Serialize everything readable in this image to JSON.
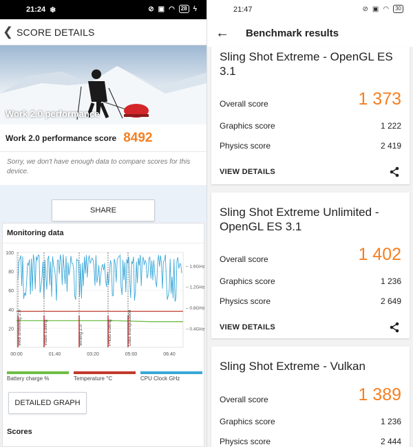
{
  "left": {
    "status": {
      "time": "21:24",
      "battery": "28"
    },
    "appbar": {
      "back_glyph": "❮",
      "title": "SCORE DETAILS"
    },
    "hero": {
      "label": "Work 2.0 performance"
    },
    "score": {
      "label": "Work 2.0 performance score",
      "value": "8492"
    },
    "compare_text": "Sorry, we don't have enough data to compare scores for this device.",
    "share_label": "SHARE",
    "monitoring": {
      "title": "Monitoring data",
      "detailed_label": "DETAILED GRAPH",
      "scores_label": "Scores"
    },
    "colors": {
      "accent": "#f57f20",
      "battery": "#6fbd45",
      "temperature": "#c0392b",
      "cpu": "#3aa8d8"
    }
  },
  "chart_data": {
    "type": "line",
    "xlabel": "",
    "ylabel": "",
    "x_ticks": [
      "00:00",
      "01:40",
      "03:20",
      "05:00",
      "06:40"
    ],
    "y_ticks_left": [
      "20",
      "40",
      "60",
      "80",
      "100"
    ],
    "y_ticks_right": [
      "0.4GHz",
      "0.8GHz",
      "1.2GHz",
      "1.6GHz"
    ],
    "ylim": [
      0,
      100
    ],
    "sections": [
      "Web Browsing 2.0",
      "Video Editing",
      "Writing 2.0",
      "Photo Editing",
      "Data Manipulation"
    ],
    "legend": [
      {
        "name": "Battery charge %",
        "color": "#6fbd45"
      },
      {
        "name": "Temperature °C",
        "color": "#c0392b"
      },
      {
        "name": "CPU Clock GHz",
        "color": "#3aa8d8"
      }
    ],
    "series": [
      {
        "name": "Battery charge %",
        "values": [
          28,
          28,
          28,
          28,
          27,
          27
        ]
      },
      {
        "name": "Temperature °C",
        "values": [
          38,
          38,
          38,
          38,
          38,
          38
        ]
      }
    ]
  },
  "right": {
    "status": {
      "time": "21:47",
      "battery": "30"
    },
    "appbar": {
      "title": "Benchmark results"
    },
    "cards": [
      {
        "title": "Sling Shot Extreme - OpenGL ES 3.1",
        "overall_label": "Overall score",
        "overall": "1 373",
        "graphics_label": "Graphics score",
        "graphics": "1 222",
        "physics_label": "Physics score",
        "physics": "2 419",
        "view_label": "VIEW DETAILS"
      },
      {
        "title": "Sling Shot Extreme Unlimited - OpenGL ES 3.1",
        "overall_label": "Overall score",
        "overall": "1 402",
        "graphics_label": "Graphics score",
        "graphics": "1 236",
        "physics_label": "Physics score",
        "physics": "2 649",
        "view_label": "VIEW DETAILS"
      },
      {
        "title": "Sling Shot Extreme - Vulkan",
        "overall_label": "Overall score",
        "overall": "1 389",
        "graphics_label": "Graphics score",
        "graphics": "1 236",
        "physics_label": "Physics score",
        "physics": "2 444"
      }
    ]
  }
}
